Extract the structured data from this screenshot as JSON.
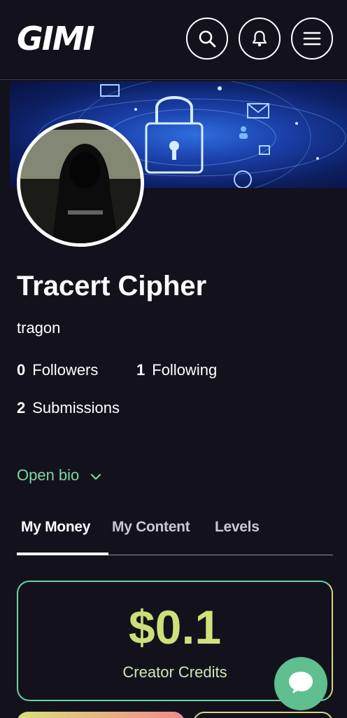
{
  "header": {
    "logo": "GIMI",
    "search_icon": "search-icon",
    "bell_icon": "bell-icon",
    "menu_icon": "hamburger-menu-icon"
  },
  "profile": {
    "name": "Tracert Cipher",
    "handle": "tragon",
    "followers_count": "0",
    "followers_label": "Followers",
    "following_count": "1",
    "following_label": "Following",
    "submissions_count": "2",
    "submissions_label": "Submissions",
    "open_bio": "Open bio"
  },
  "tabs": [
    {
      "label": "My Money",
      "active": true
    },
    {
      "label": "My Content",
      "active": false
    },
    {
      "label": "Levels",
      "active": false
    }
  ],
  "credits": {
    "amount": "$0.1",
    "label": "Creator Credits"
  },
  "colors": {
    "background": "#13121c",
    "accent_green": "#7ed6a0",
    "accent_yellow": "#e6e07a",
    "chat_button": "#5fbf8f"
  }
}
